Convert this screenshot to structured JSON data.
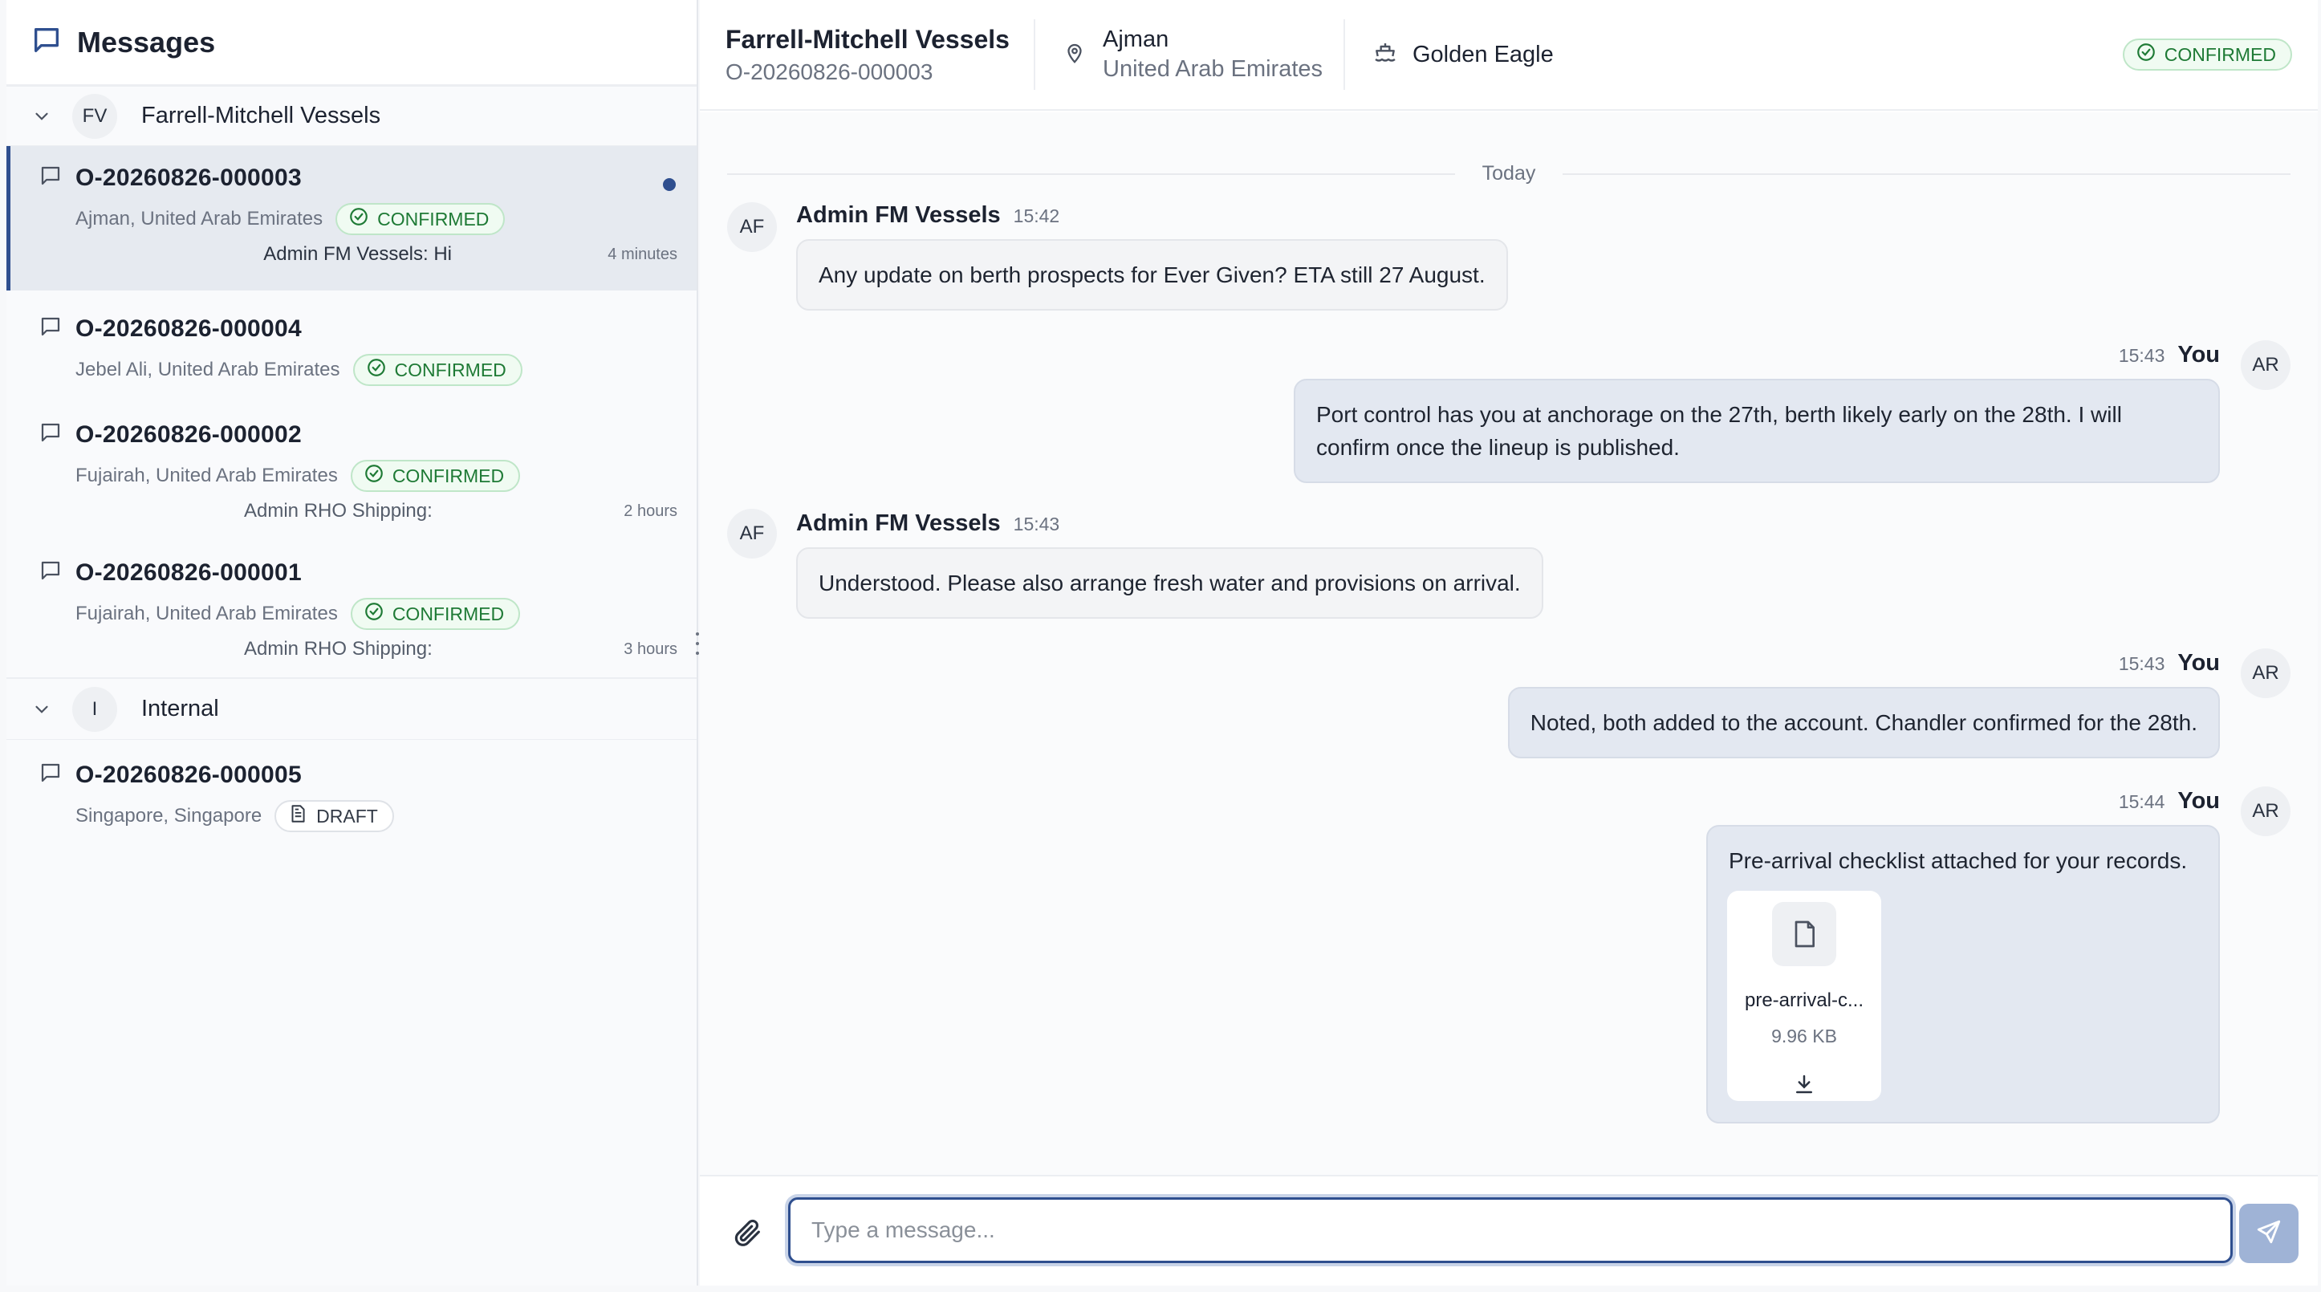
{
  "sidebar": {
    "title": "Messages",
    "groups": [
      {
        "initials": "FV",
        "name": "Farrell-Mitchell Vessels",
        "conversations": [
          {
            "id": "O-20260826-000003",
            "location": "Ajman, United Arab Emirates",
            "status": "CONFIRMED",
            "last_message": "Admin FM Vessels: Hi",
            "time": "4 minutes",
            "unread": true,
            "active": true
          },
          {
            "id": "O-20260826-000004",
            "location": "Jebel Ali, United Arab Emirates",
            "status": "CONFIRMED",
            "last_message": "",
            "time": ""
          },
          {
            "id": "O-20260826-000002",
            "location": "Fujairah, United Arab Emirates",
            "status": "CONFIRMED",
            "last_message": "Admin RHO Shipping:",
            "time": "2 hours"
          },
          {
            "id": "O-20260826-000001",
            "location": "Fujairah, United Arab Emirates",
            "status": "CONFIRMED",
            "last_message": "Admin RHO Shipping:",
            "time": "3 hours"
          }
        ]
      },
      {
        "initials": "I",
        "name": "Internal",
        "conversations": [
          {
            "id": "O-20260826-000005",
            "location": "Singapore, Singapore",
            "status": "DRAFT"
          }
        ]
      }
    ]
  },
  "header": {
    "company": "Farrell-Mitchell Vessels",
    "order_id": "O-20260826-000003",
    "city": "Ajman",
    "country": "United Arab Emirates",
    "vessel": "Golden Eagle",
    "status": "CONFIRMED"
  },
  "chat": {
    "date_divider": "Today",
    "messages": [
      {
        "initials": "AF",
        "sender": "Admin FM Vessels",
        "time": "15:42",
        "text": "Any update on berth prospects for Ever Given? ETA still 27 August."
      },
      {
        "initials": "AR",
        "sender": "You",
        "time": "15:43",
        "text": "Port control has you at anchorage on the 27th, berth likely early on the 28th. I will confirm once the lineup is published."
      },
      {
        "initials": "AF",
        "sender": "Admin FM Vessels",
        "time": "15:43",
        "text": "Understood. Please also arrange fresh water and provisions on arrival."
      },
      {
        "initials": "AR",
        "sender": "You",
        "time": "15:43",
        "text": "Noted, both added to the account. Chandler confirmed for the 28th."
      },
      {
        "initials": "AR",
        "sender": "You",
        "time": "15:44",
        "text": "Pre-arrival checklist attached for your records.",
        "attachment": {
          "name": "pre-arrival-c...",
          "size": "9.96 KB"
        }
      }
    ]
  },
  "composer": {
    "placeholder": "Type a message...",
    "value": ""
  },
  "colors": {
    "accent": "#2f4f8f",
    "confirmed_text": "#1e7a35",
    "confirmed_bg": "#f0fbf2",
    "outgoing_bubble": "#e3e8f1",
    "incoming_bubble": "#f3f4f6",
    "send_button": "#9fb3d6"
  },
  "icons": {
    "sidebar_header": "message-square-icon",
    "conversation": "message-square-icon",
    "group_toggle": "chevron-down-icon",
    "confirmed": "check-circle-icon",
    "draft": "file-text-icon",
    "location": "map-pin-icon",
    "vessel": "ship-icon",
    "attachment_file": "file-icon",
    "download": "download-icon",
    "attach": "paperclip-icon",
    "send": "send-icon"
  }
}
